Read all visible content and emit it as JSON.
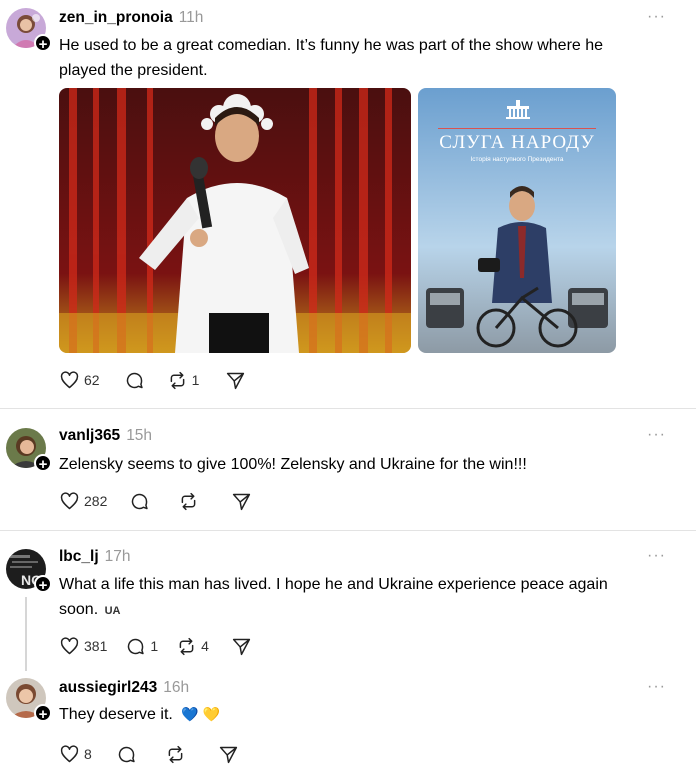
{
  "posts": [
    {
      "username": "zen_in_pronoia",
      "time": "11h",
      "text": "He used to be a great comedian. It’s funny he was part of the show where he played the president.",
      "likes": "62",
      "comments": "",
      "reposts": "1",
      "media": {
        "poster_title": "СЛУГА НАРОДУ",
        "poster_subtitle": "Історія наступного Президента"
      }
    },
    {
      "username": "vanlj365",
      "time": "15h",
      "text": "Zelensky seems to give 100%! Zelensky and Ukraine for the win!!!",
      "likes": "282",
      "comments": "",
      "reposts": ""
    },
    {
      "username": "lbc_lj",
      "time": "17h",
      "text": "What a life this man has lived. I hope he and Ukraine experience peace again soon.",
      "flag": "UA",
      "likes": "381",
      "comments": "1",
      "reposts": "4"
    },
    {
      "username": "aussiegirl243",
      "time": "16h",
      "text": "They deserve it.",
      "emoji": "💙 💛",
      "likes": "8",
      "comments": "",
      "reposts": ""
    }
  ],
  "more_label": "···",
  "follow_label": "+"
}
